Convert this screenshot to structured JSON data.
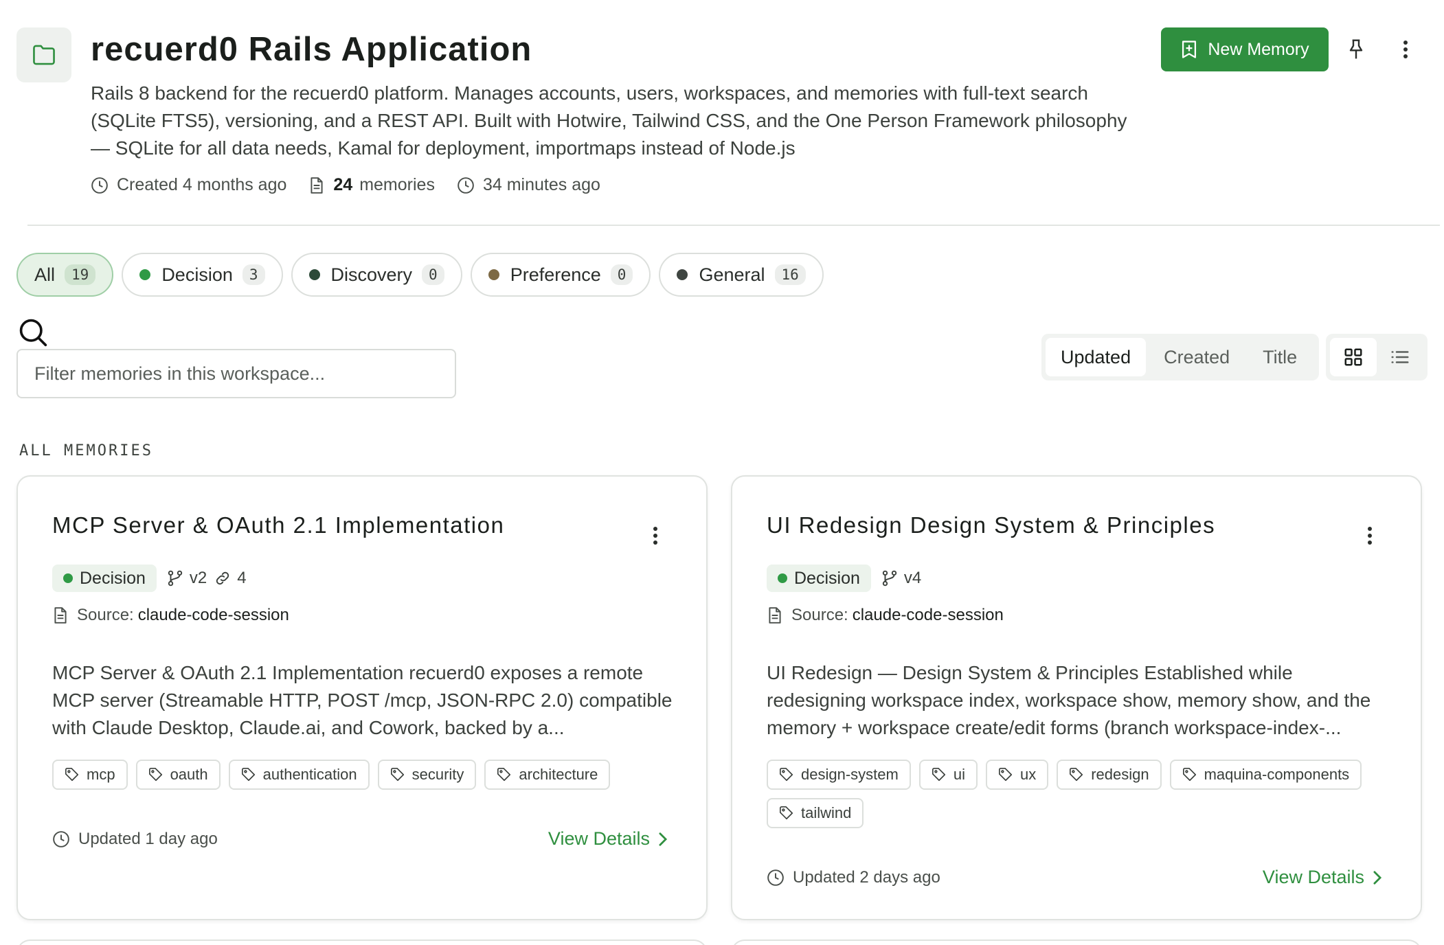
{
  "workspace": {
    "title": "recuerd0 Rails Application",
    "description": "Rails 8 backend for the recuerd0 platform. Manages accounts, users, workspaces, and memories with full-text search (SQLite FTS5), versioning, and a REST API. Built with Hotwire, Tailwind CSS, and the One Person Framework philosophy — SQLite for all data needs, Kamal for deployment, importmaps instead of Node.js",
    "created": "Created 4 months ago",
    "memory_count": "24",
    "memory_label": "memories",
    "updated": "34 minutes ago",
    "icon": "folder-icon"
  },
  "header_actions": {
    "new_memory_label": "New Memory",
    "new_memory_icon": "bookmark-plus-icon",
    "pin_icon": "pin-icon",
    "menu_icon": "more-vertical-icon"
  },
  "filters": [
    {
      "label": "All",
      "count": "19",
      "active": true,
      "color": null
    },
    {
      "label": "Decision",
      "count": "3",
      "active": false,
      "color": "#2f9a45"
    },
    {
      "label": "Discovery",
      "count": "0",
      "active": false,
      "color": "#2c4a38"
    },
    {
      "label": "Preference",
      "count": "0",
      "active": false,
      "color": "#7d6a45"
    },
    {
      "label": "General",
      "count": "16",
      "active": false,
      "color": "#3f4541"
    }
  ],
  "search": {
    "placeholder": "Filter memories in this workspace..."
  },
  "sort": {
    "options": [
      "Updated",
      "Created",
      "Title"
    ],
    "selected": "Updated"
  },
  "view_toggle": {
    "grid_icon": "grid-icon",
    "list_icon": "list-icon",
    "selected": "grid"
  },
  "section_label": "ALL MEMORIES",
  "memories": [
    {
      "title": "MCP Server & OAuth 2.1 Implementation",
      "type": "Decision",
      "version": "v2",
      "links": "4",
      "source_label": "Source:",
      "source": "claude-code-session",
      "excerpt": "MCP Server & OAuth 2.1 Implementation recuerd0 exposes a remote MCP server (Streamable HTTP, POST /mcp, JSON-RPC 2.0) compatible with Claude Desktop, Claude.ai, and Cowork, backed by a...",
      "tags": [
        "mcp",
        "oauth",
        "authentication",
        "security",
        "architecture"
      ],
      "updated": "Updated 1 day ago",
      "view_label": "View Details"
    },
    {
      "title": "UI Redesign Design System & Principles",
      "type": "Decision",
      "version": "v4",
      "links": null,
      "source_label": "Source:",
      "source": "claude-code-session",
      "excerpt": "UI Redesign — Design System & Principles Established while redesigning workspace index, workspace show, memory show, and the memory + workspace create/edit forms (branch workspace-index-...",
      "tags": [
        "design-system",
        "ui",
        "ux",
        "redesign",
        "maquina-components",
        "tailwind"
      ],
      "updated": "Updated 2 days ago",
      "view_label": "View Details"
    }
  ],
  "colors": {
    "accent": "#2f8f3f",
    "decision": "#2f9a45"
  }
}
